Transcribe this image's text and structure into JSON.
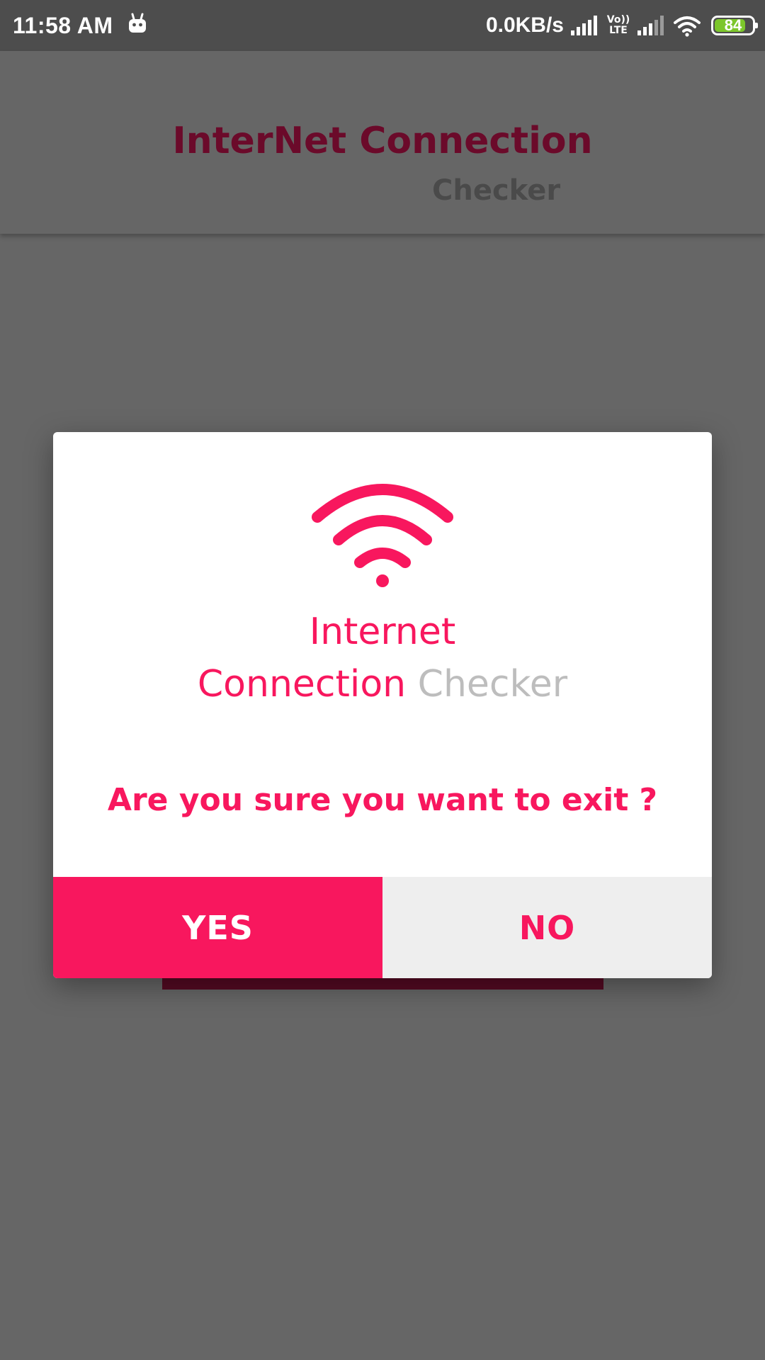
{
  "status_bar": {
    "time": "11:58 AM",
    "net_speed": "0.0KB/s",
    "volte_top": "Vo))",
    "volte_bottom": "LTE",
    "battery_level": "84",
    "battery_fraction": 0.84,
    "battery_color": "#7cc62b"
  },
  "app_bar": {
    "title": "InterNet Connection",
    "subtitle": "Checker"
  },
  "dialog": {
    "icon": "wifi-icon",
    "app_name_line1": "Internet",
    "app_name_line2_word": "Connection",
    "app_name_line2_muted": "Checker",
    "message": "Are you sure you want to exit ?",
    "yes_label": "YES",
    "no_label": "NO"
  },
  "colors": {
    "accent": "#f8175e",
    "dim_overlay_bg": "#666666",
    "status_bar_bg": "#4d4d4d",
    "no_button_bg": "#eeeeee",
    "muted_text": "#bdbdbd"
  }
}
